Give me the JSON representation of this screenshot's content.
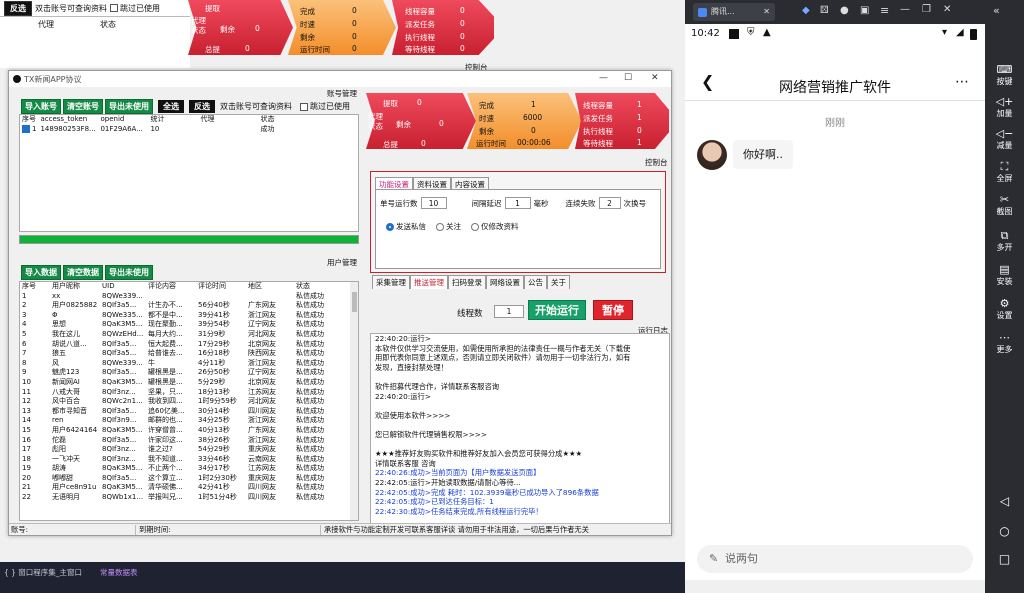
{
  "bg_window": {
    "reverse_btn": "反选",
    "dbl_hint": "双击账号可查询资料",
    "skip_used": "跳过已使用",
    "col_proxy": "代理",
    "col_status": "状态",
    "shapes": {
      "proxy_status": "代理\n状态",
      "fetch": "提取",
      "fetch_val": "0",
      "remain": "剩余",
      "remain_val": "0",
      "total": "总提",
      "total_val": "0",
      "done": "完成",
      "done_val": "0",
      "interval": "时速",
      "interval_val": "0",
      "left": "剩余",
      "left_val": "0",
      "runtime": "运行时间",
      "runtime_val": "0",
      "threads": "线程容量",
      "threads_val": "0",
      "dispatch": "派发任务",
      "dispatch_val": "0",
      "exec": "执行线程",
      "exec_val": "0",
      "wait": "等待线程",
      "wait_val": "0"
    },
    "console_label": "控制台"
  },
  "main": {
    "title": "TX新闻APP协议",
    "account_label": "账号管理",
    "toolbar": {
      "import": "导入账号",
      "clear": "清空账号",
      "export": "导出未使用",
      "select_all": "全选",
      "invert": "反选",
      "dbl_hint": "双击账号可查询资料",
      "skip_used": "跳过已使用"
    },
    "acct_cols": [
      "序号",
      "access_token",
      "openid",
      "统计",
      "代理",
      "状态"
    ],
    "acct_rows": [
      [
        "1",
        "148980253F8...",
        "01F29A6A...",
        "10",
        "",
        "成功"
      ]
    ],
    "user_label": "用户管理",
    "user_toolbar": {
      "import": "导入数据",
      "clear": "清空数据",
      "export": "导出未使用"
    },
    "user_cols": [
      "序号",
      "用户昵称",
      "UID",
      "评论内容",
      "评论时间",
      "地区",
      "状态"
    ],
    "user_rows": [
      [
        "1",
        "xx",
        "8QWe339...",
        "",
        "",
        "",
        "私信成功"
      ],
      [
        "2",
        "用户0825882",
        "8QIf3a5...",
        "计生办不...",
        "56分40秒",
        "广东网友",
        "私信成功"
      ],
      [
        "3",
        "Φ",
        "8QWe335...",
        "都不是中...",
        "39分41秒",
        "浙江网友",
        "私信成功"
      ],
      [
        "4",
        "思想",
        "8QaK3M5...",
        "现在聚勤...",
        "39分54秒",
        "辽宁网友",
        "私信成功"
      ],
      [
        "5",
        "我在这儿",
        "8QWzEHd...",
        "每月大约...",
        "31分9秒",
        "河北网友",
        "私信成功"
      ],
      [
        "6",
        "胡说八道...",
        "8QIf3a5...",
        "恒大起费...",
        "17分29秒",
        "北京网友",
        "私信成功"
      ],
      [
        "7",
        "狼五",
        "8QIf3a5...",
        "给普谁去...",
        "16分18秒",
        "陕西网友",
        "私信成功"
      ],
      [
        "8",
        "风",
        "8QWe339...",
        "牛",
        "4分11秒",
        "浙江网友",
        "私信成功"
      ],
      [
        "9",
        "魅虎123",
        "8QIf3a5...",
        "罐根黑是...",
        "26分50秒",
        "辽宁网友",
        "私信成功"
      ],
      [
        "10",
        "新闻网AI",
        "8QaK3M5...",
        "罐根黑是...",
        "5分29秒",
        "北京网友",
        "私信成功"
      ],
      [
        "11",
        "八戒大哥",
        "8QIf3nz...",
        "坚果，只...",
        "18分13秒",
        "江苏网友",
        "私信成功"
      ],
      [
        "12",
        "风中百合",
        "8QWc2n1...",
        "我收到四...",
        "1时9分59秒",
        "河北网友",
        "私信成功"
      ],
      [
        "13",
        "都市寻知音",
        "8QIf3a5...",
        "追60亿美...",
        "30分14秒",
        "四川网友",
        "私信成功"
      ],
      [
        "14",
        "ren",
        "8QIf3n9...",
        "邮群的也...",
        "34分25秒",
        "浙江网友",
        "私信成功"
      ],
      [
        "15",
        "用户6424164",
        "8QaK3M5...",
        "许穿僧曾...",
        "40分13秒",
        "广东网友",
        "私信成功"
      ],
      [
        "16",
        "佗磊",
        "8QIf3a5...",
        "许家印这...",
        "38分26秒",
        "浙江网友",
        "私信成功"
      ],
      [
        "17",
        "彪阳",
        "8QIf3nz...",
        "谁之过?",
        "54分29秒",
        "重庆网友",
        "私信成功"
      ],
      [
        "18",
        "一飞冲天",
        "8QIf3nz...",
        "我不知道...",
        "33分46秒",
        "云南网友",
        "私信成功"
      ],
      [
        "19",
        "胡涛",
        "8QaK3M5...",
        "不止两个...",
        "34分17秒",
        "江苏网友",
        "私信成功"
      ],
      [
        "20",
        "嘟嘟甜",
        "8QIf3a5...",
        "这个算立...",
        "1时2分30秒",
        "重庆网友",
        "私信成功"
      ],
      [
        "21",
        "用户ce8n91u",
        "8QaK3M5...",
        "清华硕佛...",
        "42分41秒",
        "四川网友",
        "私信成功"
      ],
      [
        "22",
        "无语明月",
        "8QWb1x1...",
        "举报叫兄...",
        "1时51分4秒",
        "四川网友",
        "私信成功"
      ]
    ],
    "shapes": {
      "proxy_status": "代理\n状态",
      "fetch": "提取",
      "fetch_val": "0",
      "remain": "剩余",
      "remain_val": "0",
      "total": "总提",
      "total_val": "0",
      "done": "完成",
      "done_val": "1",
      "interval": "时速",
      "interval_val": "6000",
      "left": "剩余",
      "left_val": "0",
      "runtime": "运行时间",
      "runtime_val": "00:00:06",
      "threads": "线程容量",
      "threads_val": "1",
      "dispatch": "派发任务",
      "dispatch_val": "1",
      "exec": "执行线程",
      "exec_val": "0",
      "wait": "等待线程",
      "wait_val": "1"
    },
    "console_label": "控制台",
    "settings": {
      "tabs": [
        "功能设置",
        "资料设置",
        "内容设置"
      ],
      "single_run": "单号运行数",
      "single_run_val": "10",
      "interval": "间隔延迟",
      "interval_val": "1",
      "ms": "毫秒",
      "fail": "连续失败",
      "fail_val": "2",
      "switch": "次换号",
      "radios": [
        "发送私信",
        "关注",
        "仅修改资料"
      ]
    },
    "bottom_tabs": [
      "采集管理",
      "推送管理",
      "扫码登录",
      "网络设置",
      "公告",
      "关于"
    ],
    "thread_label": "线程数",
    "thread_val": "1",
    "start": "开始运行",
    "stop": "暂停",
    "log_label": "运行日志",
    "log_lines": [
      {
        "t": "22:40:20:运行>",
        "c": ""
      },
      {
        "t": "本软件仅供学习交流使用，如需使用所承担的法律责任一概与作者无关（下载使",
        "c": ""
      },
      {
        "t": "用即代表你同意上述观点，否则请立即关闭软件）请勿用于一切非法行为，如有",
        "c": ""
      },
      {
        "t": "发现，直接封禁处理！",
        "c": ""
      },
      {
        "t": "",
        "c": ""
      },
      {
        "t": "软件招募代理合作，详情联系客服咨询",
        "c": ""
      },
      {
        "t": "22:40:20:运行>",
        "c": ""
      },
      {
        "t": "",
        "c": ""
      },
      {
        "t": "                    欢迎使用本软件>>>>",
        "c": ""
      },
      {
        "t": "",
        "c": ""
      },
      {
        "t": "            您已解锁软件代理销售权限>>>>",
        "c": ""
      },
      {
        "t": "",
        "c": ""
      },
      {
        "t": "★★★推荐好友购买软件和推荐好友加入会员您可获得分成★★★",
        "c": ""
      },
      {
        "t": "详情联系客服  咨询",
        "c": ""
      },
      {
        "t": "22:40:26:成功>当前页面为【用户数据发送页面】",
        "c": "blue"
      },
      {
        "t": "22:42:05:运行>开始读取数据/请耐心等待...",
        "c": ""
      },
      {
        "t": "22:42:05:成功>完成 耗时：102.3939毫秒已成功导入了896条数据",
        "c": "blue"
      },
      {
        "t": "22:42:05:成功>已到达任务目标：1",
        "c": "blue"
      },
      {
        "t": "22:42:30:成功>任务结束完成,所有线程运行完毕！",
        "c": "blue"
      }
    ],
    "status_account": "账号:",
    "status_expire": "到期时间:",
    "status_notice": "承接软件与功能定制开发可联系客服详谈    请勿用于非法用途，一切后果与作者无关"
  },
  "taskbar": {
    "item1": "{ } 窗口程序集_主窗口",
    "item2": "常量数据表"
  },
  "phone": {
    "tab_title": "腾讯...",
    "time": "10:42",
    "chat_title": "网络营销推广软件",
    "timestamp": "刚刚",
    "message": "你好啊..",
    "input_placeholder": "说两句"
  },
  "sidebar": {
    "items": [
      "按键",
      "加量",
      "减量",
      "全屏",
      "截图",
      "多开",
      "安装",
      "设置",
      "更多"
    ]
  }
}
